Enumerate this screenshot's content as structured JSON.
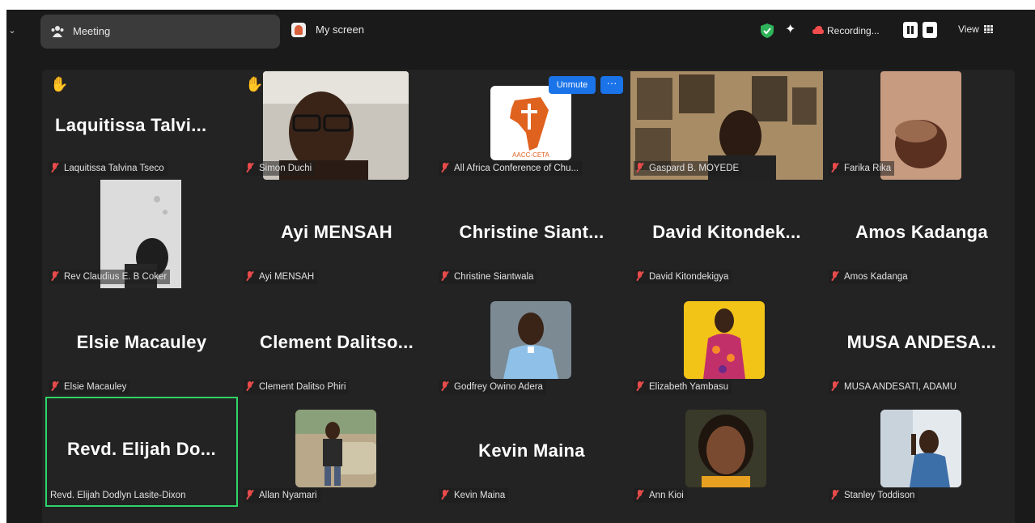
{
  "topbar": {
    "meeting_tab_label": "Meeting",
    "screen_tab_label": "My screen",
    "recording_label": "Recording...",
    "view_label": "View",
    "icons": [
      "chevron-down-icon",
      "meeting-icon",
      "screen-icon",
      "shield-check-icon",
      "sparkle-icon",
      "cloud-icon",
      "pause-icon",
      "stop-icon",
      "grid-icon"
    ],
    "accent_green": "#2fd467",
    "accent_blue": "#1a73e8"
  },
  "overlay": {
    "unmute_label": "Unmute",
    "more_label": "···"
  },
  "tiles": [
    {
      "display_name": "Laquitissa  Talvi...",
      "label": "Laquitissa Talvina Tseco",
      "hand": true
    },
    {
      "display_name": "",
      "label": "Simon Duchi",
      "hand": true
    },
    {
      "display_name": "",
      "label": "All Africa Conference of Chu..."
    },
    {
      "display_name": "",
      "label": "Gaspard B. MOYEDE"
    },
    {
      "display_name": "",
      "label": "Farika Rika"
    },
    {
      "display_name": "",
      "label": "Rev Claudius E. B Coker"
    },
    {
      "display_name": "Ayi MENSAH",
      "label": "Ayi MENSAH"
    },
    {
      "display_name": "Christine  Siant...",
      "label": "Christine Siantwala"
    },
    {
      "display_name": "David  Kitondek...",
      "label": "David Kitondekigya"
    },
    {
      "display_name": "Amos Kadanga",
      "label": "Amos Kadanga"
    },
    {
      "display_name": "Elsie Macauley",
      "label": "Elsie Macauley"
    },
    {
      "display_name": "Clement  Dalitso...",
      "label": "Clement Dalitso Phiri"
    },
    {
      "display_name": "",
      "label": "Godfrey Owino Adera"
    },
    {
      "display_name": "",
      "label": "Elizabeth Yambasu"
    },
    {
      "display_name": "MUSA  ANDESA...",
      "label": "MUSA ANDESATI, ADAMU"
    },
    {
      "display_name": "Revd.  Elijah  Do...",
      "label": "Revd. Elijah Dodlyn Lasite-Dixon"
    },
    {
      "display_name": "",
      "label": "Allan Nyamari"
    },
    {
      "display_name": "Kevin Maina",
      "label": "Kevin Maina"
    },
    {
      "display_name": "",
      "label": "Ann Kioi"
    },
    {
      "display_name": "",
      "label": "Stanley Toddison"
    }
  ],
  "logo_text": "AACC-CETA"
}
